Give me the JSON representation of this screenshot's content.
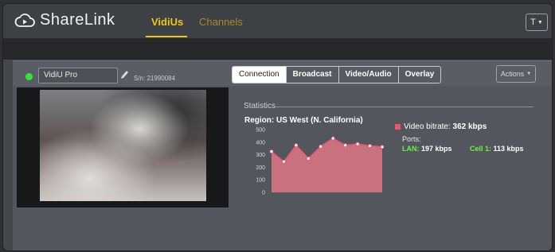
{
  "app": {
    "logo_text": "ShareLink",
    "nav": [
      {
        "label": "VidiUs",
        "active": true
      },
      {
        "label": "Channels",
        "active": false
      }
    ],
    "user_initial": "T"
  },
  "device": {
    "name": "VidiU Pro",
    "serial": "S/n: 21990084",
    "status_color": "#2ee63a",
    "tabs": [
      "Connection",
      "Broadcast",
      "Video/Audio",
      "Overlay"
    ],
    "active_tab": "Connection",
    "actions_label": "Actions"
  },
  "stats": {
    "title": "Statistics",
    "region": "Region: US West (N. California)",
    "legend_prefix": "Video bitrate: ",
    "legend_value": "362 kbps",
    "ports_label": "Ports:",
    "lan_label": "LAN:",
    "lan_value": "197 kbps",
    "cell_label": "Cell 1:",
    "cell_value": "113 kbps"
  },
  "chart_data": {
    "type": "area",
    "y_ticks": [
      "500",
      "400",
      "300",
      "200",
      "100",
      "0"
    ],
    "ylim": [
      0,
      500
    ],
    "values": [
      325,
      245,
      375,
      270,
      365,
      430,
      375,
      385,
      370,
      362
    ],
    "color": "#e8586f",
    "fill": "#c9717f",
    "grid": true
  }
}
